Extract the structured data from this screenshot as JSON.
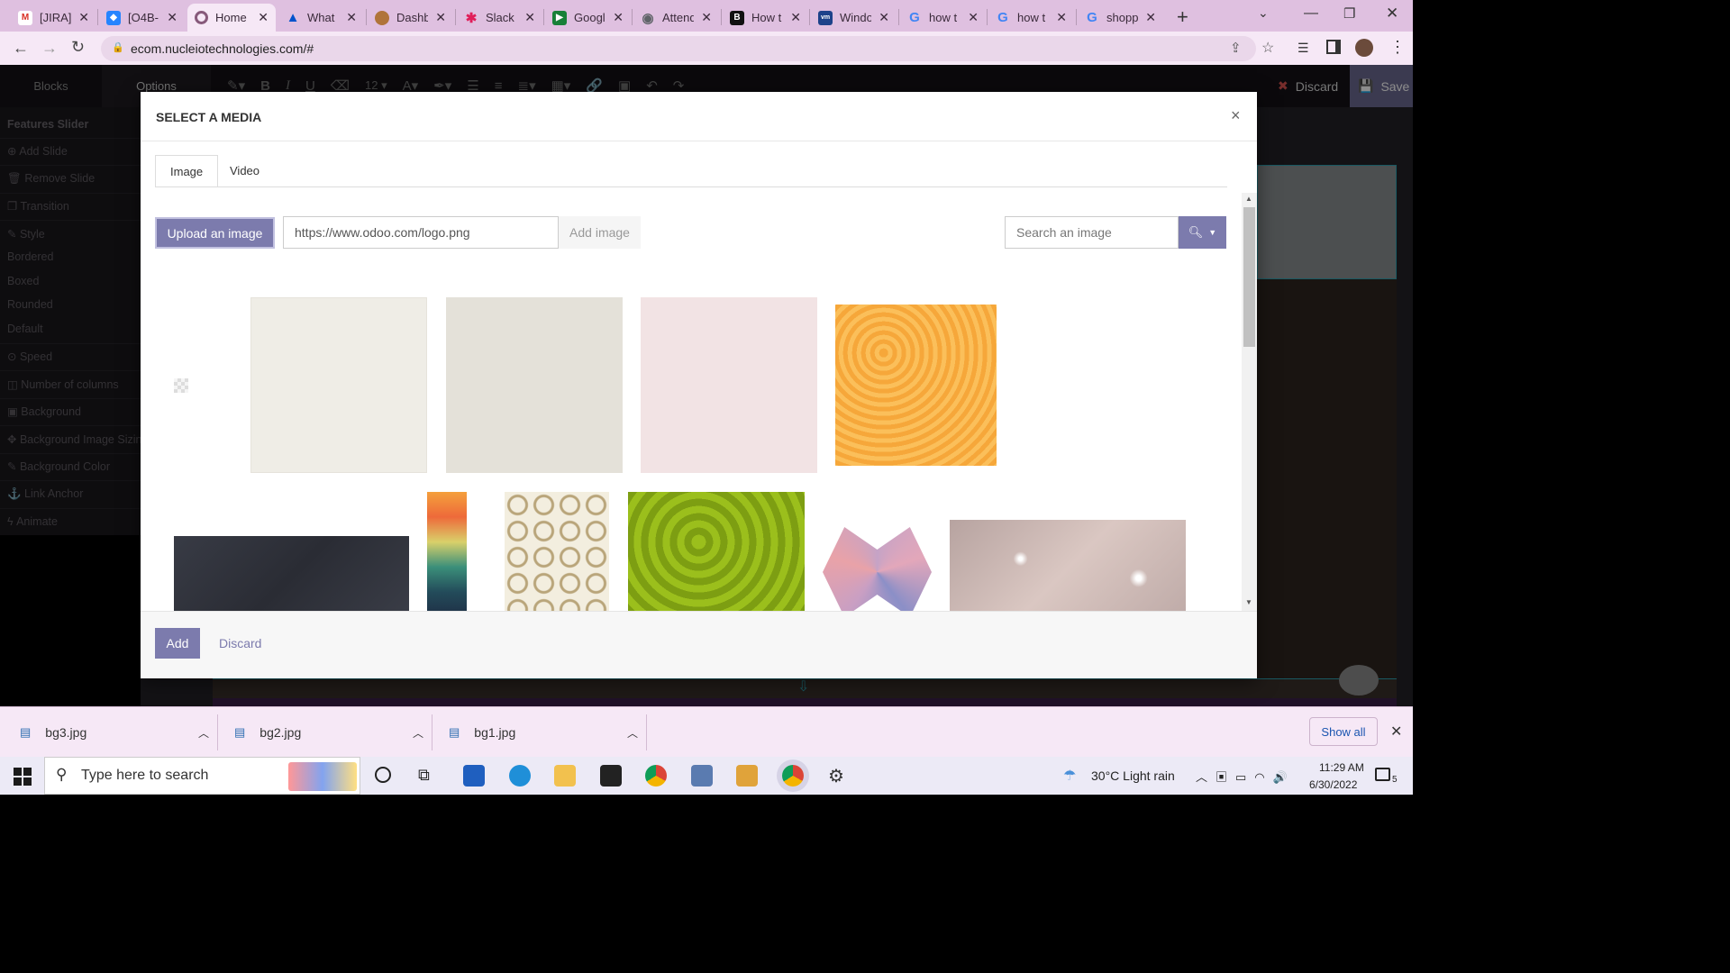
{
  "browser": {
    "tabs": [
      {
        "label": "[JIRA]",
        "icon": "gmail-icon",
        "color": "#d93025"
      },
      {
        "label": "[O4B-",
        "icon": "jira-icon",
        "color": "#2684ff"
      },
      {
        "label": "Home",
        "icon": "odoo-icon",
        "color": "#875a7b"
      },
      {
        "label": "What",
        "icon": "atlassian-icon",
        "color": "#0052cc"
      },
      {
        "label": "Dashb",
        "icon": "dashboard-icon",
        "color": "#b0743a"
      },
      {
        "label": "Slack",
        "icon": "slack-icon",
        "color": "#e01e5a"
      },
      {
        "label": "Googl",
        "icon": "google-meet-icon",
        "color": "#188038"
      },
      {
        "label": "Attend",
        "icon": "globe-icon",
        "color": "#5f6368"
      },
      {
        "label": "How t",
        "icon": "b-icon",
        "color": "#111111"
      },
      {
        "label": "Windo",
        "icon": "vmware-icon",
        "color": "#1d428a"
      },
      {
        "label": "how t",
        "icon": "google-icon",
        "color": "#4285f4"
      },
      {
        "label": "how t",
        "icon": "google-icon",
        "color": "#4285f4"
      },
      {
        "label": "shopp",
        "icon": "google-icon",
        "color": "#4285f4"
      }
    ],
    "url": "ecom.nucleiotechnologies.com/#"
  },
  "editor": {
    "blocks_tab": "Blocks",
    "options_tab": "Options",
    "font_size": "12",
    "discard": "Discard",
    "save": "Save",
    "section_title": "Features Slider",
    "sidebar_items": [
      "Add Slide",
      "Remove Slide",
      "Transition",
      "Style",
      "Bordered",
      "Boxed",
      "Rounded",
      "Default",
      "Speed",
      "Number of columns",
      "Background",
      "Background Image Sizing",
      "Background Color",
      "Link Anchor",
      "Animate"
    ]
  },
  "modal": {
    "title": "SELECT A MEDIA",
    "close": "×",
    "tabs": [
      "Image",
      "Video"
    ],
    "upload_label": "Upload an image",
    "url_value": "https://www.odoo.com/logo.png",
    "add_image_label": "Add image",
    "search_placeholder": "Search an image",
    "add_label": "Add",
    "discard_label": "Discard"
  },
  "downloads": {
    "files": [
      "bg3.jpg",
      "bg2.jpg",
      "bg1.jpg"
    ],
    "show_all": "Show all"
  },
  "taskbar": {
    "search_placeholder": "Type here to search",
    "weather": "30°C  Light rain",
    "time": "11:29 AM",
    "date": "6/30/2022",
    "notifications": "5"
  },
  "colors": {
    "accent": "#7c7bad",
    "browser_chrome": "#dfc0e0"
  }
}
